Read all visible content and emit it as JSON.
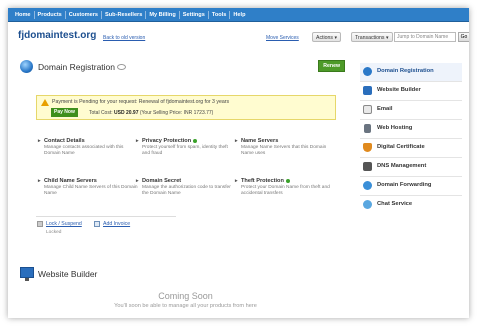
{
  "nav": [
    "Home",
    "Products",
    "Customers",
    "Sub-Resellers",
    "My Billing",
    "Settings",
    "Tools",
    "Help"
  ],
  "header": {
    "domain": "fjdomaintest.org",
    "back_link": "Back to old version",
    "move_services": "Move Services",
    "actions": "Actions ▾",
    "transactions": "Transactions ▾",
    "search_placeholder": "Jump to Domain Name",
    "go": "Go"
  },
  "domain_registration": {
    "title": "Domain Registration",
    "renew": "Renew",
    "pending_msg": "Payment is Pending for your request: Renewal of fjdomaintest.org for 3 years",
    "pay_now": "Pay Now",
    "total_cost_label": "Total Cost:",
    "total_cost_value": "USD 20.97",
    "selling_price": "(Your Selling Price:  INR 1723.77)"
  },
  "features": [
    {
      "title": "Contact Details",
      "desc": "Manage contacts associated with this Domain Name",
      "dot": false
    },
    {
      "title": "Privacy Protection",
      "desc": "Protect yourself from spam, identity theft and fraud",
      "dot": true
    },
    {
      "title": "Name Servers",
      "desc": "Manage Name Servers that this Domain Name uses",
      "dot": false
    },
    {
      "title": "Child Name Servers",
      "desc": "Manage Child Name Servers of this Domain Name",
      "dot": false
    },
    {
      "title": "Domain Secret",
      "desc": "Manage the authorization code to transfer the Domain Name",
      "dot": false
    },
    {
      "title": "Theft Protection",
      "desc": "Protect your Domain Name from theft and accidental transfers",
      "dot": true
    }
  ],
  "actions_links": {
    "lock": "Lock / Suspend",
    "add_invoice": "Add Invoice",
    "locked": "Locked"
  },
  "website_builder": {
    "title": "Website Builder",
    "coming_soon": "Coming Soon",
    "coming_sub": "You'll soon be able to manage all your products from here"
  },
  "sidebar": [
    {
      "label": "Domain Registration",
      "icon": "globe-icon",
      "color": "#2a78c8",
      "active": true
    },
    {
      "label": "Website Builder",
      "icon": "monitor-icon",
      "color": "#2a6ebc",
      "active": false
    },
    {
      "label": "Email",
      "icon": "envelope-icon",
      "color": "#8a8a8a",
      "active": false
    },
    {
      "label": "Web Hosting",
      "icon": "server-icon",
      "color": "#6a7480",
      "active": false
    },
    {
      "label": "Digital Certificate",
      "icon": "shield-icon",
      "color": "#e08a1e",
      "active": false
    },
    {
      "label": "DNS Management",
      "icon": "network-icon",
      "color": "#555555",
      "active": false
    },
    {
      "label": "Domain Forwarding",
      "icon": "forward-icon",
      "color": "#3a8fd8",
      "active": false
    },
    {
      "label": "Chat Service",
      "icon": "chat-icon",
      "color": "#5aa7e0",
      "active": false
    }
  ]
}
